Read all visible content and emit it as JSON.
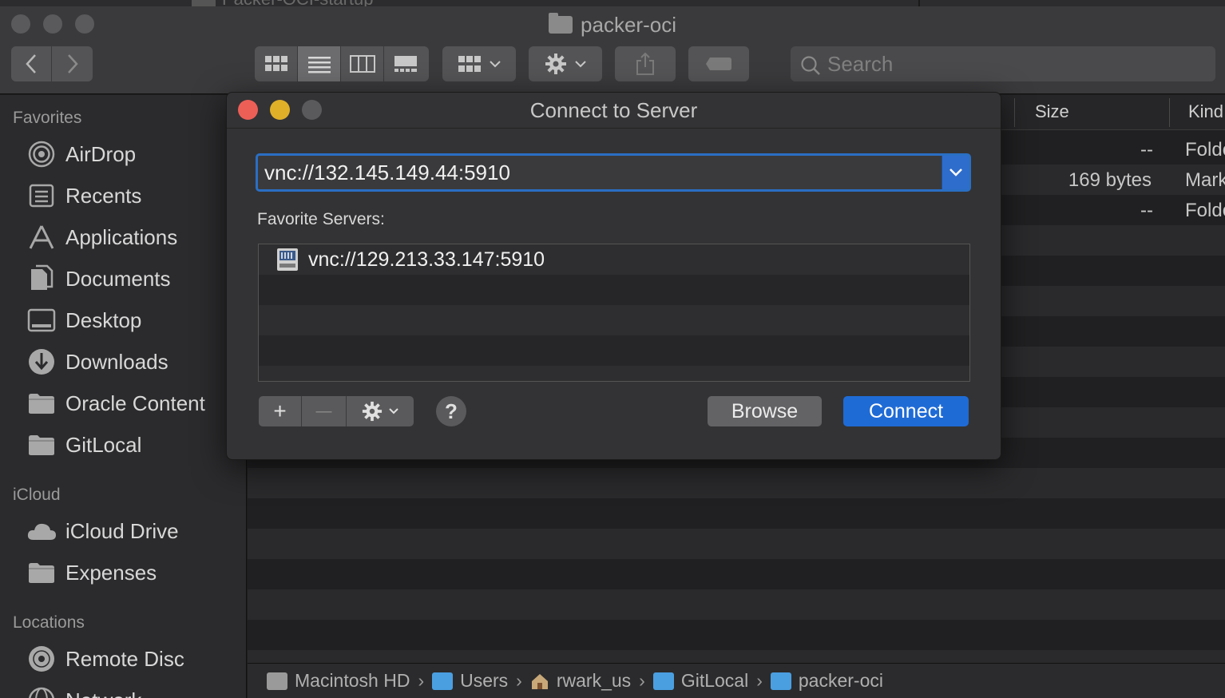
{
  "window": {
    "background_window_title_fragment": "Packer-OCI-startup",
    "title": "packer-oci",
    "search_placeholder": "Search"
  },
  "sidebar": {
    "sections": [
      {
        "label": "Favorites",
        "items": [
          {
            "label": "AirDrop",
            "icon": "airdrop-icon"
          },
          {
            "label": "Recents",
            "icon": "recents-icon"
          },
          {
            "label": "Applications",
            "icon": "applications-icon"
          },
          {
            "label": "Documents",
            "icon": "documents-icon"
          },
          {
            "label": "Desktop",
            "icon": "desktop-icon"
          },
          {
            "label": "Downloads",
            "icon": "downloads-icon"
          },
          {
            "label": "Oracle Content",
            "icon": "folder-icon"
          },
          {
            "label": "GitLocal",
            "icon": "folder-icon"
          }
        ]
      },
      {
        "label": "iCloud",
        "items": [
          {
            "label": "iCloud Drive",
            "icon": "cloud-icon"
          },
          {
            "label": "Expenses",
            "icon": "folder-icon"
          }
        ]
      },
      {
        "label": "Locations",
        "items": [
          {
            "label": "Remote Disc",
            "icon": "disc-icon"
          },
          {
            "label": "Network",
            "icon": "network-icon"
          }
        ]
      }
    ]
  },
  "file_list": {
    "columns": {
      "size": "Size",
      "kind": "Kind"
    },
    "rows": [
      {
        "size": "--",
        "kind": "Folder"
      },
      {
        "size": "169 bytes",
        "kind": "Markdown"
      },
      {
        "size": "--",
        "kind": "Folder"
      }
    ]
  },
  "pathbar": [
    "Macintosh HD",
    "Users",
    "rwark_us",
    "GitLocal",
    "packer-oci"
  ],
  "dialog": {
    "title": "Connect to Server",
    "address_value": "vnc://132.145.149.44:5910",
    "favorites_label": "Favorite Servers:",
    "favorites": [
      "vnc://129.213.33.147:5910"
    ],
    "add_label": "+",
    "remove_label": "—",
    "help_label": "?",
    "browse_label": "Browse",
    "connect_label": "Connect"
  },
  "colors": {
    "accent": "#1f6bd6",
    "close": "#ec5f57",
    "minimize": "#e0b028",
    "disabled": "#5a5a5c"
  }
}
